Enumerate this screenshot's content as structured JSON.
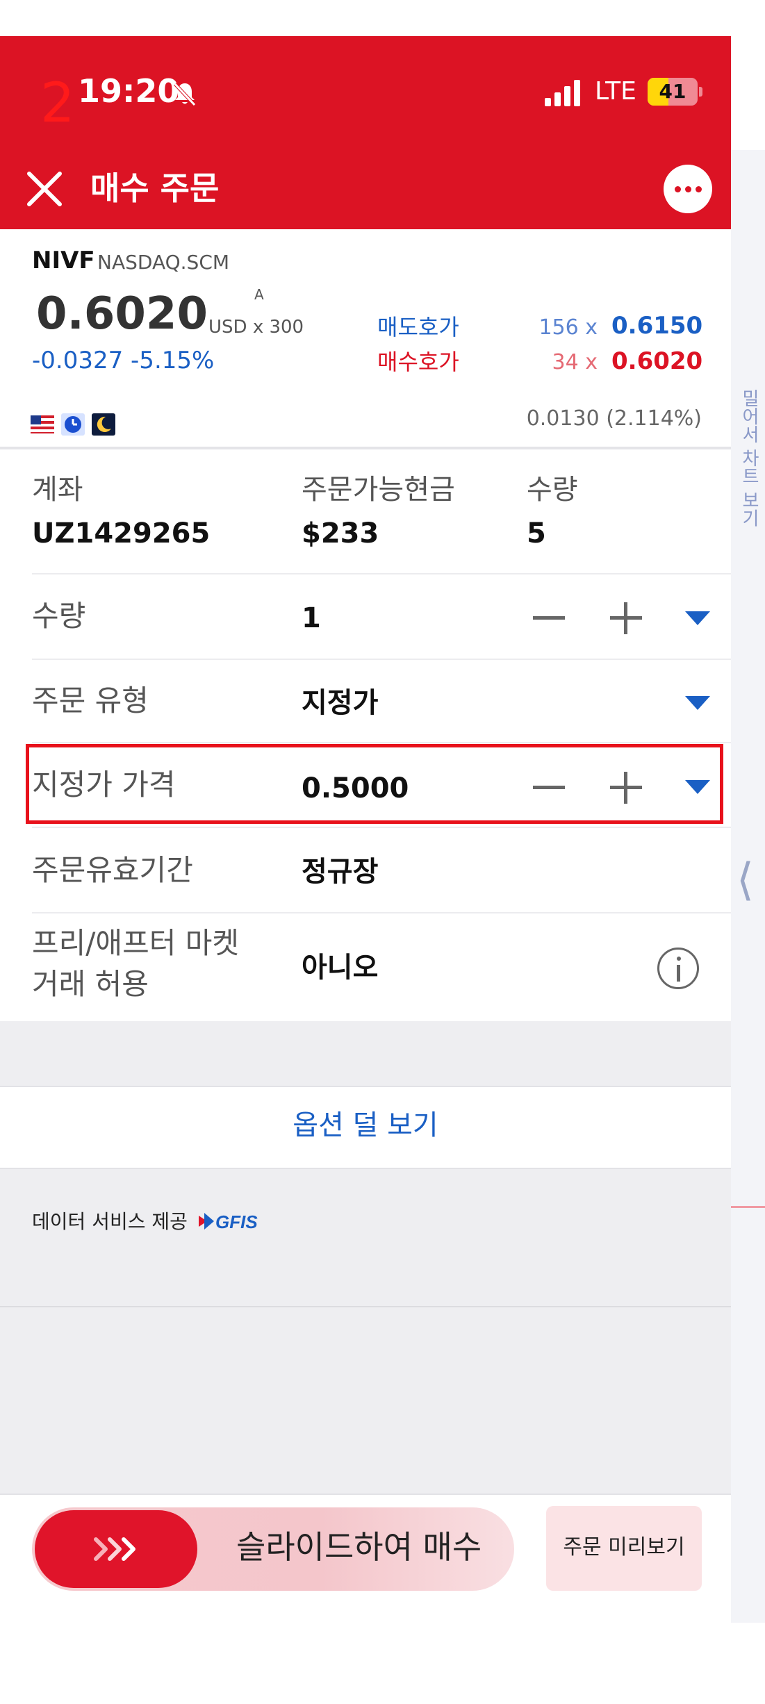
{
  "status_bar": {
    "step_number": "2",
    "time": "19:20",
    "network": "LTE",
    "battery": "41",
    "battery_level": 0.41
  },
  "header": {
    "title": "매수 주문"
  },
  "quote": {
    "symbol": "NIVF",
    "market": "NASDAQ.SCM",
    "price": "0.6020",
    "superscript": "A",
    "currency_multiplier": "USD x 300",
    "change": "-0.0327  -5.15%",
    "ask_label": "매도호가",
    "bid_label": "매수호가",
    "ask_qty": "156 x",
    "bid_qty": "34 x",
    "ask_price": "0.6150",
    "bid_price": "0.6020",
    "spread": "0.0130 (2.114%)"
  },
  "account": {
    "account_label": "계좌",
    "account_value": "UZ1429265",
    "cash_label": "주문가능현금",
    "cash_value": "$233",
    "qty_label": "수량",
    "qty_value": "5"
  },
  "form": {
    "quantity_label": "수량",
    "quantity_value": "1",
    "order_type_label": "주문 유형",
    "order_type_value": "지정가",
    "limit_price_label": "지정가 가격",
    "limit_price_value": "0.5000",
    "validity_label": "주문유효기간",
    "validity_value": "정규장",
    "extended_label_line1": "프리/애프터 마켓",
    "extended_label_line2": "거래 허용",
    "extended_value": "아니오"
  },
  "options_toggle": "옵션 덜 보기",
  "data_credit": "데이터 서비스 제공",
  "data_provider_logo": "GFIS",
  "side_panel": {
    "label": "밀어서 차트 보기"
  },
  "bottom": {
    "slide_label": "슬라이드하여 매수",
    "preview_label": "주문 미리보기"
  },
  "colors": {
    "brand_red": "#dc1324",
    "link_blue": "#1a5fc4",
    "highlight": "#e8111b"
  }
}
